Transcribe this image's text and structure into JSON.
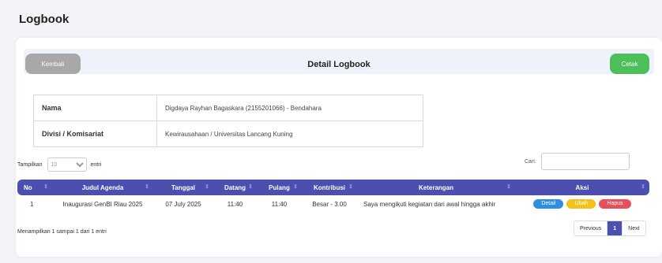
{
  "page_title": "Logbook",
  "header": {
    "back_label": "Kembali",
    "title": "Detail Logbook",
    "print_label": "Cetak"
  },
  "info": [
    {
      "key": "Nama",
      "value": "Digdaya Rayhan Bagaskara (2155201066) - Bendahara"
    },
    {
      "key": "Divisi / Komisariat",
      "value": "Kewirausahaan / Universitas Lancang Kuning"
    }
  ],
  "length": {
    "prefix": "Tampilkan",
    "value": "10",
    "suffix": "entri"
  },
  "search": {
    "label": "Cari:"
  },
  "table": {
    "columns": [
      "No",
      "Judul Agenda",
      "Tanggal",
      "Datang",
      "Pulang",
      "Kontribusi",
      "Keterangan",
      "Aksi"
    ],
    "rows": [
      {
        "no": "1",
        "judul": "Inaugurasi GenBI Riau 2025",
        "tanggal": "07 July 2025",
        "datang": "11:40",
        "pulang": "11:40",
        "kontribusi": "Besar - 3.00",
        "keterangan": "Saya mengikuti kegiatan dari awal hingga akhir"
      }
    ],
    "actions": {
      "detail": "Detail",
      "edit": "Ubah",
      "delete": "Hapus"
    }
  },
  "footer_info": "Menampilkan 1 sampai 1 dari 1 entri",
  "pagination": {
    "previous": "Previous",
    "current": "1",
    "next": "Next"
  },
  "colors": {
    "primary": "#4b4fb0",
    "print": "#4cbf5a",
    "back": "#a8a8a8",
    "detail": "#2f8fde",
    "edit": "#f2c21b",
    "delete": "#e64f5b"
  }
}
